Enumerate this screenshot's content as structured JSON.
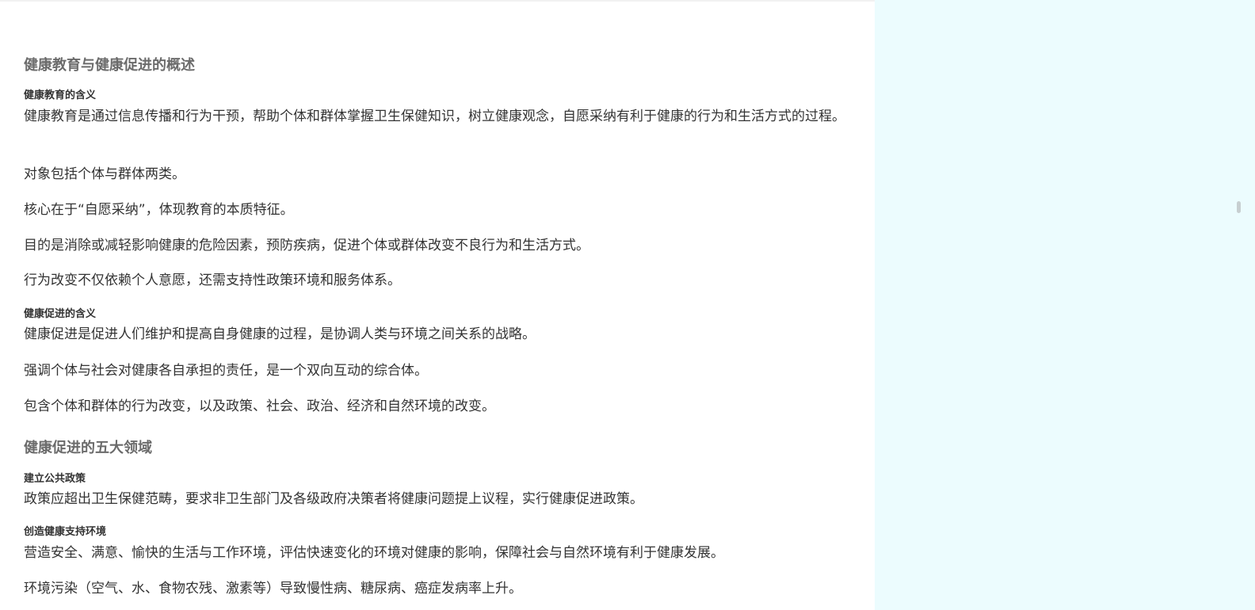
{
  "document": {
    "sections": [
      {
        "heading": "健康教育与健康促进的概述",
        "subsections": [
          {
            "title": "健康教育的含义",
            "paragraphs": [
              "健康教育是通过信息传播和行为干预，帮助个体和群体掌握卫生保健知识，树立健康观念，自愿采纳有利于健康的行为和生活方式的过程。",
              "对象包括个体与群体两类。",
              "核心在于“自愿采纳”，体现教育的本质特征。",
              "目的是消除或减轻影响健康的危险因素，预防疾病，促进个体或群体改变不良行为和生活方式。",
              "行为改变不仅依赖个人意愿，还需支持性政策环境和服务体系。"
            ]
          },
          {
            "title": "健康促进的含义",
            "paragraphs": [
              "健康促进是促进人们维护和提高自身健康的过程，是协调人类与环境之间关系的战略。",
              "强调个体与社会对健康各自承担的责任，是一个双向互动的综合体。",
              "包含个体和群体的行为改变，以及政策、社会、政治、经济和自然环境的改变。"
            ]
          }
        ]
      },
      {
        "heading": "健康促进的五大领域",
        "subsections": [
          {
            "title": "建立公共政策",
            "paragraphs": [
              "政策应超出卫生保健范畴，要求非卫生部门及各级政府决策者将健康问题提上议程，实行健康促进政策。"
            ]
          },
          {
            "title": "创造健康支持环境",
            "paragraphs": [
              "营造安全、满意、愉快的生活与工作环境，评估快速变化的环境对健康的影响，保障社会与自然环境有利于健康发展。",
              "环境污染（空气、水、食物农残、激素等）导致慢性病、糖尿病、癌症发病率上升。"
            ]
          }
        ]
      }
    ]
  },
  "colors": {
    "side_panel": "#ecfcfe",
    "heading": "#6b6b6b",
    "text": "#333333"
  }
}
